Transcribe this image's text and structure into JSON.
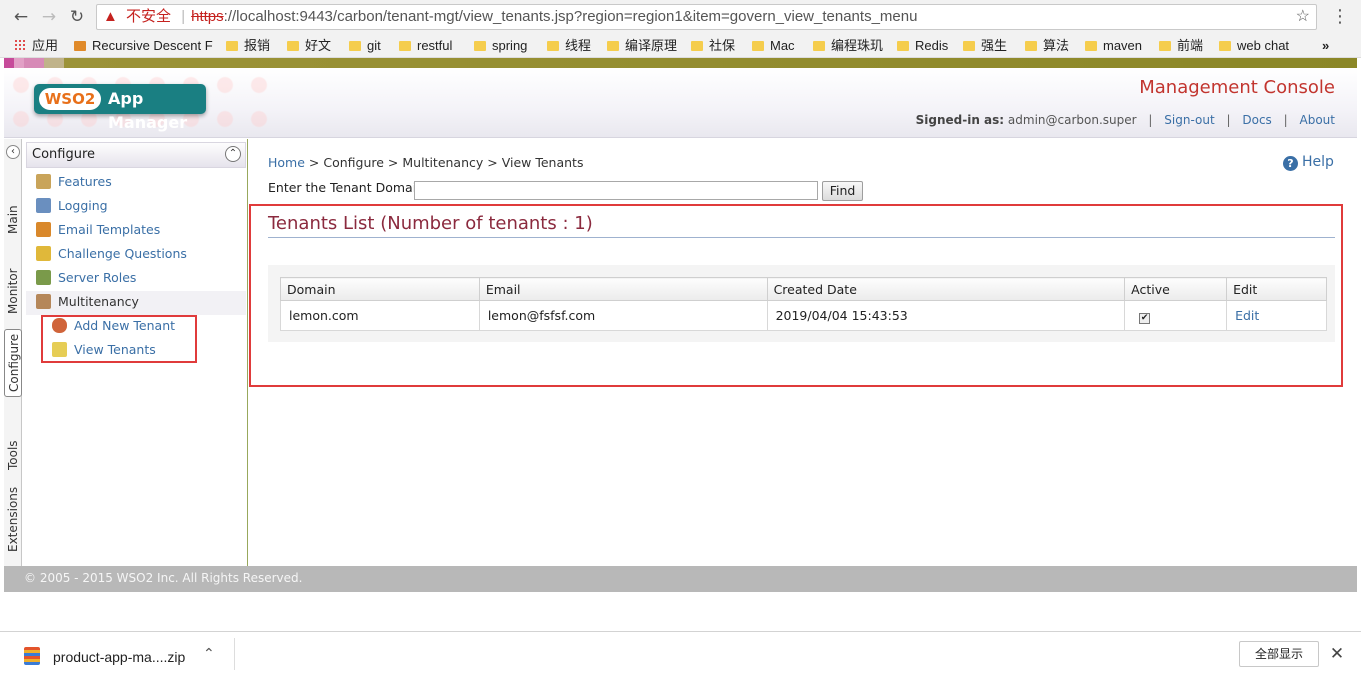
{
  "browser": {
    "back_icon": "arrow-left-icon",
    "forward_icon": "arrow-right-icon",
    "reload_icon": "reload-icon",
    "security_warning": "不安全",
    "url_scheme": "https",
    "url_rest": "://localhost:9443/carbon/tenant-mgt/view_tenants.jsp?region=region1&item=govern_view_tenants_menu",
    "bookmarks": [
      "应用",
      "Recursive Descent F",
      "报销",
      "好文",
      "git",
      "restful",
      "spring",
      "线程",
      "编译原理",
      "社保",
      "Mac",
      "编程珠玑",
      "Redis",
      "强生",
      "算法",
      "maven",
      "前端",
      "web chat"
    ],
    "more_bookmarks": "»"
  },
  "header": {
    "logo_brand": "WSO2",
    "logo_product": "App Manager",
    "console_title": "Management Console",
    "signed_in_label": "Signed-in as:",
    "signed_in_user": "admin@carbon.super",
    "signout": "Sign-out",
    "docs": "Docs",
    "about": "About"
  },
  "vertical_tabs": [
    "Main",
    "Monitor",
    "Configure",
    "Tools",
    "Extensions"
  ],
  "sidebar": {
    "section": "Configure",
    "items": [
      {
        "label": "Features",
        "icon": "features-icon"
      },
      {
        "label": "Logging",
        "icon": "logging-icon"
      },
      {
        "label": "Email Templates",
        "icon": "email-templates-icon"
      },
      {
        "label": "Challenge Questions",
        "icon": "challenge-questions-icon"
      },
      {
        "label": "Server Roles",
        "icon": "server-roles-icon"
      },
      {
        "label": "Multitenancy",
        "icon": "multitenancy-icon"
      },
      {
        "label": "Add New Tenant",
        "icon": "add-tenant-icon"
      },
      {
        "label": "View Tenants",
        "icon": "view-tenants-icon"
      }
    ]
  },
  "breadcrumb": {
    "home": "Home",
    "sep": " > ",
    "configure": "Configure",
    "multitenancy": "Multitenancy",
    "current": "View Tenants"
  },
  "help": "Help",
  "search": {
    "label": "Enter the Tenant Domain",
    "value": "",
    "button": "Find"
  },
  "tenants": {
    "title": "Tenants List (Number of tenants : 1)",
    "columns": [
      "Domain",
      "Email",
      "Created Date",
      "Active",
      "Edit"
    ],
    "rows": [
      {
        "domain": "lemon.com",
        "email": "lemon@fsfsf.com",
        "created": "2019/04/04 15:43:53",
        "active": true,
        "edit": "Edit"
      }
    ]
  },
  "footer": "© 2005 - 2015 WSO2 Inc. All Rights Reserved.",
  "downloads": {
    "file": "product-app-ma....zip",
    "show_all": "全部显示",
    "close": "✕"
  },
  "colors": {
    "accent_link": "#3a6fa6",
    "title_red": "#c2352f",
    "list_title": "#8b2a3e",
    "highlight_box": "#e03b3b",
    "logo_teal": "#1a7f82"
  }
}
